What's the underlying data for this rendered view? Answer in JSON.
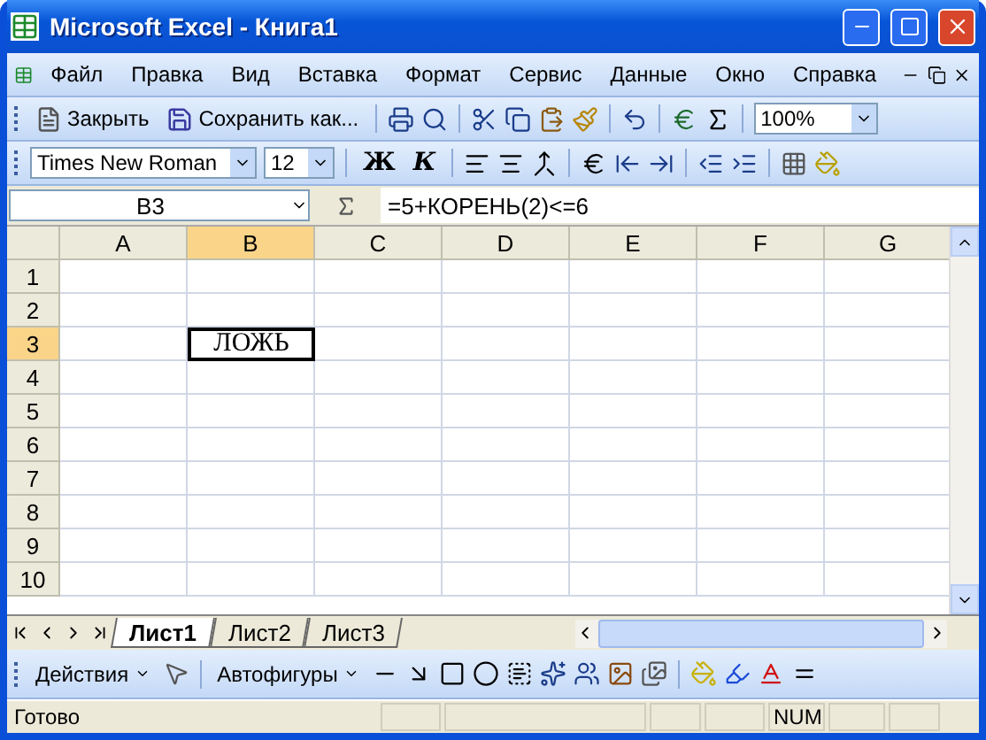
{
  "window": {
    "title": "Microsoft Excel - Книга1"
  },
  "menu": [
    {
      "label": "Файл"
    },
    {
      "label": "Правка"
    },
    {
      "label": "Вид"
    },
    {
      "label": "Вставка"
    },
    {
      "label": "Формат"
    },
    {
      "label": "Сервис"
    },
    {
      "label": "Данные"
    },
    {
      "label": "Окно"
    },
    {
      "label": "Справка"
    }
  ],
  "standard_toolbar": {
    "close": "Закрыть",
    "save_as": "Сохранить как...",
    "zoom": "100%"
  },
  "formatting_toolbar": {
    "font": "Times New Roman",
    "size": "12",
    "bold": "Ж",
    "italic": "К"
  },
  "formula_bar": {
    "name_box": "B3",
    "formula": "=5+КОРЕНЬ(2)<=6"
  },
  "sheet": {
    "columns": [
      {
        "label": "A",
        "selected": false
      },
      {
        "label": "B",
        "selected": true
      },
      {
        "label": "C",
        "selected": false
      },
      {
        "label": "D",
        "selected": false
      },
      {
        "label": "E",
        "selected": false
      },
      {
        "label": "F",
        "selected": false
      },
      {
        "label": "G",
        "selected": false
      }
    ],
    "rows": [
      {
        "label": "1",
        "selected": false
      },
      {
        "label": "2",
        "selected": false
      },
      {
        "label": "3",
        "selected": true
      },
      {
        "label": "4",
        "selected": false
      },
      {
        "label": "5",
        "selected": false
      },
      {
        "label": "6",
        "selected": false
      },
      {
        "label": "7",
        "selected": false
      },
      {
        "label": "8",
        "selected": false
      },
      {
        "label": "9",
        "selected": false
      },
      {
        "label": "10",
        "selected": false
      }
    ],
    "active_cell_value": "ЛОЖЬ"
  },
  "sheet_tabs": [
    {
      "label": "Лист1",
      "selected": true
    },
    {
      "label": "Лист2",
      "selected": false
    },
    {
      "label": "Лист3",
      "selected": false
    }
  ],
  "drawing_toolbar": {
    "actions": "Действия",
    "autoshapes": "Автофигуры"
  },
  "status_bar": {
    "status": "Готово",
    "num": "NUM"
  }
}
